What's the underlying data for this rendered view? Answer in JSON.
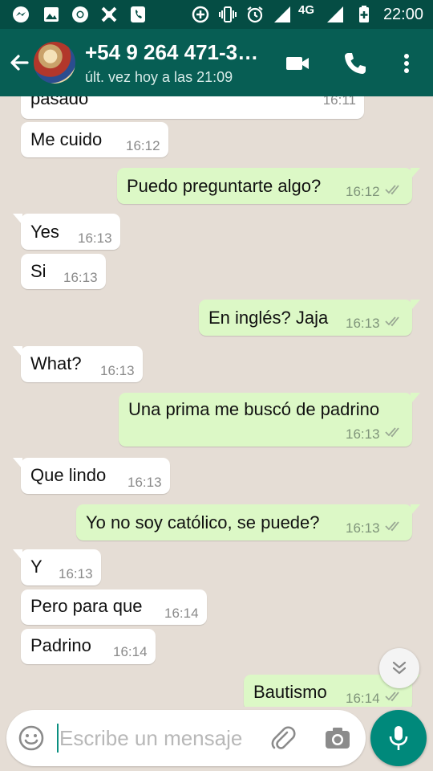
{
  "status_bar": {
    "network": "4G",
    "time": "22:00",
    "icons": [
      "messenger-icon",
      "gallery-icon",
      "chrome-icon",
      "app-icon",
      "phone-app-icon",
      "data-saver-icon",
      "vibrate-icon",
      "alarm-icon",
      "signal-icon",
      "signal-icon",
      "battery-charging-icon"
    ]
  },
  "header": {
    "title": "+54 9 264 471-3…",
    "subtitle": "últ. vez hoy a las 21:09",
    "icons": [
      "back-arrow-icon",
      "video-call-icon",
      "phone-icon",
      "more-vert-icon"
    ]
  },
  "messages": [
    {
      "dir": "in",
      "text": "pasado",
      "time": "16:11"
    },
    {
      "dir": "in",
      "text": "Me cuido",
      "time": "16:12"
    },
    {
      "dir": "out",
      "text": "Puedo preguntarte algo?",
      "time": "16:12"
    },
    {
      "dir": "in",
      "text": "Yes",
      "time": "16:13"
    },
    {
      "dir": "in",
      "text": "Si",
      "time": "16:13"
    },
    {
      "dir": "out",
      "text": "En inglés? Jaja",
      "time": "16:13"
    },
    {
      "dir": "in",
      "text": "What?",
      "time": "16:13"
    },
    {
      "dir": "out",
      "text": "Una prima me buscó de padrino",
      "time": "16:13"
    },
    {
      "dir": "in",
      "text": "Que lindo",
      "time": "16:13"
    },
    {
      "dir": "out",
      "text": "Yo no soy católico, se puede?",
      "time": "16:13"
    },
    {
      "dir": "in",
      "text": "Y",
      "time": "16:13"
    },
    {
      "dir": "in",
      "text": "Pero para que",
      "time": "16:14"
    },
    {
      "dir": "in",
      "text": "Padrino",
      "time": "16:14"
    },
    {
      "dir": "out",
      "text": "Bautismo",
      "time": "16:14"
    }
  ],
  "composer": {
    "placeholder": "Escribe un mensaje",
    "icons": [
      "emoji-icon",
      "attach-icon",
      "camera-icon",
      "mic-icon"
    ]
  },
  "colors": {
    "status_bar": "#054d44",
    "app_bar": "#075e54",
    "chat_background": "#e5ddd5",
    "incoming_bubble": "#ffffff",
    "outgoing_bubble": "#dcf8c6",
    "mic_button": "#00897b",
    "read_ticks": "#9aa894"
  }
}
